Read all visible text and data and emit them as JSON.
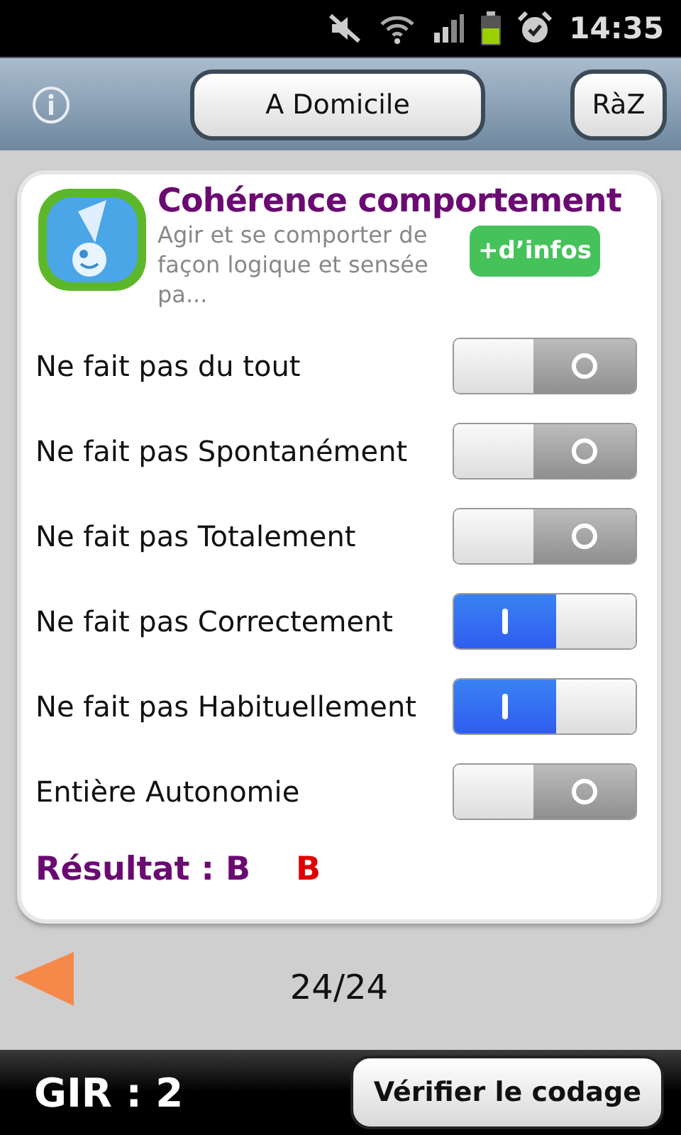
{
  "status_bar": {
    "time": "14:35"
  },
  "toolbar": {
    "location_button": "A Domicile",
    "reset_button": "RàZ"
  },
  "card": {
    "title": "Cohérence comportement",
    "description": "Agir et se comporter de façon logique et sensée pa...",
    "more_button": "+d’infos",
    "rows": [
      {
        "label": "Ne fait pas du tout",
        "on": false
      },
      {
        "label": "Ne fait pas Spontanément",
        "on": false
      },
      {
        "label": "Ne fait pas Totalement",
        "on": false
      },
      {
        "label": "Ne fait pas Correctement",
        "on": true
      },
      {
        "label": "Ne fait pas Habituellement",
        "on": true
      },
      {
        "label": "Entière Autonomie",
        "on": false
      }
    ],
    "result": {
      "label": "Résultat : B",
      "value": "B"
    }
  },
  "pager": "24/24",
  "footer": {
    "gir": "GIR : 2",
    "verify_button": "Vérifier le codage"
  }
}
